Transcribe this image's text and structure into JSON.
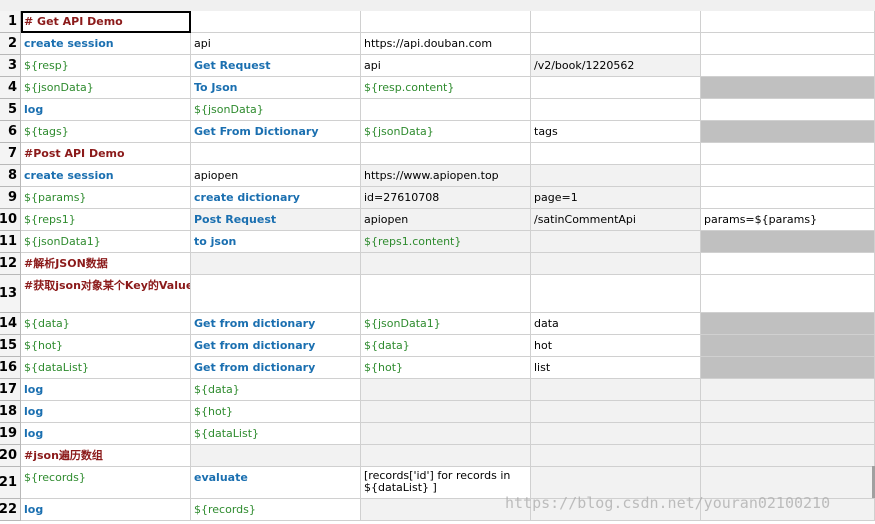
{
  "rows": [
    {
      "n": "1",
      "cells": [
        {
          "t": "# Get API Demo",
          "s": "cmt"
        },
        {
          "t": "",
          "s": "plain"
        },
        {
          "t": "",
          "s": "plain"
        },
        {
          "t": "",
          "s": "plain"
        },
        {
          "t": "",
          "s": "plain"
        }
      ]
    },
    {
      "n": "2",
      "cells": [
        {
          "t": "create session",
          "s": "kw"
        },
        {
          "t": "api",
          "s": "plain"
        },
        {
          "t": "https://api.douban.com",
          "s": "plain"
        },
        {
          "t": "",
          "s": "plain"
        },
        {
          "t": "",
          "s": "plain"
        }
      ]
    },
    {
      "n": "3",
      "cells": [
        {
          "t": "${resp}",
          "s": "var"
        },
        {
          "t": "Get Request",
          "s": "kw"
        },
        {
          "t": "api",
          "s": "plain"
        },
        {
          "t": "/v2/book/1220562",
          "s": "plain"
        },
        {
          "t": "",
          "s": "plain"
        }
      ]
    },
    {
      "n": "4",
      "cells": [
        {
          "t": "${jsonData}",
          "s": "var"
        },
        {
          "t": "To Json",
          "s": "kw"
        },
        {
          "t": "${resp.content}",
          "s": "var"
        },
        {
          "t": "",
          "s": "plain"
        },
        {
          "t": "",
          "s": "plain"
        }
      ]
    },
    {
      "n": "5",
      "cells": [
        {
          "t": "log",
          "s": "kw"
        },
        {
          "t": "${jsonData}",
          "s": "var"
        },
        {
          "t": "",
          "s": "plain"
        },
        {
          "t": "",
          "s": "plain"
        },
        {
          "t": "",
          "s": "plain"
        }
      ]
    },
    {
      "n": "6",
      "cells": [
        {
          "t": "${tags}",
          "s": "var"
        },
        {
          "t": "Get From Dictionary",
          "s": "kw"
        },
        {
          "t": "${jsonData}",
          "s": "var"
        },
        {
          "t": "tags",
          "s": "plain"
        },
        {
          "t": "",
          "s": "plain"
        }
      ]
    },
    {
      "n": "7",
      "cells": [
        {
          "t": "#Post API Demo",
          "s": "cmt"
        },
        {
          "t": "",
          "s": "plain"
        },
        {
          "t": "",
          "s": "plain"
        },
        {
          "t": "",
          "s": "plain"
        },
        {
          "t": "",
          "s": "plain"
        }
      ]
    },
    {
      "n": "8",
      "cells": [
        {
          "t": "create session",
          "s": "kw"
        },
        {
          "t": "apiopen",
          "s": "plain"
        },
        {
          "t": "https://www.apiopen.top",
          "s": "plain"
        },
        {
          "t": "",
          "s": "plain"
        },
        {
          "t": "",
          "s": "plain"
        }
      ]
    },
    {
      "n": "9",
      "cells": [
        {
          "t": "${params}",
          "s": "var"
        },
        {
          "t": "create dictionary",
          "s": "kw"
        },
        {
          "t": "id=27610708",
          "s": "plain"
        },
        {
          "t": "page=1",
          "s": "plain"
        },
        {
          "t": "",
          "s": "plain"
        }
      ]
    },
    {
      "n": "10",
      "cells": [
        {
          "t": "${reps1}",
          "s": "var"
        },
        {
          "t": "Post Request",
          "s": "kw"
        },
        {
          "t": "apiopen",
          "s": "plain"
        },
        {
          "t": "/satinCommentApi",
          "s": "plain"
        },
        {
          "t": "params=${params}",
          "s": "plain"
        }
      ]
    },
    {
      "n": "11",
      "cells": [
        {
          "t": "${jsonData1}",
          "s": "var"
        },
        {
          "t": "to json",
          "s": "kw"
        },
        {
          "t": "${reps1.content}",
          "s": "var"
        },
        {
          "t": "",
          "s": "plain"
        },
        {
          "t": "",
          "s": "plain"
        }
      ]
    },
    {
      "n": "12",
      "cells": [
        {
          "t": "#解析JSON数据",
          "s": "cmt"
        },
        {
          "t": "",
          "s": "plain"
        },
        {
          "t": "",
          "s": "plain"
        },
        {
          "t": "",
          "s": "plain"
        },
        {
          "t": "",
          "s": "plain"
        }
      ]
    },
    {
      "n": "13",
      "cells": [
        {
          "t": "#获取json对象某个Key的Value",
          "s": "cmt"
        },
        {
          "t": "",
          "s": "plain"
        },
        {
          "t": "",
          "s": "plain"
        },
        {
          "t": "",
          "s": "plain"
        },
        {
          "t": "",
          "s": "plain"
        }
      ]
    },
    {
      "n": "14",
      "cells": [
        {
          "t": "${data}",
          "s": "var"
        },
        {
          "t": "Get from dictionary",
          "s": "kw"
        },
        {
          "t": "${jsonData1}",
          "s": "var"
        },
        {
          "t": "data",
          "s": "plain"
        },
        {
          "t": "",
          "s": "plain"
        }
      ]
    },
    {
      "n": "15",
      "cells": [
        {
          "t": "${hot}",
          "s": "var"
        },
        {
          "t": "Get from dictionary",
          "s": "kw"
        },
        {
          "t": "${data}",
          "s": "var"
        },
        {
          "t": "hot",
          "s": "plain"
        },
        {
          "t": "",
          "s": "plain"
        }
      ]
    },
    {
      "n": "16",
      "cells": [
        {
          "t": "${dataList}",
          "s": "var"
        },
        {
          "t": "Get from dictionary",
          "s": "kw"
        },
        {
          "t": "${hot}",
          "s": "var"
        },
        {
          "t": "list",
          "s": "plain"
        },
        {
          "t": "",
          "s": "plain"
        }
      ]
    },
    {
      "n": "17",
      "cells": [
        {
          "t": "log",
          "s": "kw"
        },
        {
          "t": "${data}",
          "s": "var"
        },
        {
          "t": "",
          "s": "plain"
        },
        {
          "t": "",
          "s": "plain"
        },
        {
          "t": "",
          "s": "plain"
        }
      ]
    },
    {
      "n": "18",
      "cells": [
        {
          "t": "log",
          "s": "kw"
        },
        {
          "t": "${hot}",
          "s": "var"
        },
        {
          "t": "",
          "s": "plain"
        },
        {
          "t": "",
          "s": "plain"
        },
        {
          "t": "",
          "s": "plain"
        }
      ]
    },
    {
      "n": "19",
      "cells": [
        {
          "t": "log",
          "s": "kw"
        },
        {
          "t": "${dataList}",
          "s": "var"
        },
        {
          "t": "",
          "s": "plain"
        },
        {
          "t": "",
          "s": "plain"
        },
        {
          "t": "",
          "s": "plain"
        }
      ]
    },
    {
      "n": "20",
      "cells": [
        {
          "t": "#json遍历数组",
          "s": "cmt"
        },
        {
          "t": "",
          "s": "plain"
        },
        {
          "t": "",
          "s": "plain"
        },
        {
          "t": "",
          "s": "plain"
        },
        {
          "t": "",
          "s": "plain"
        }
      ]
    },
    {
      "n": "21",
      "cells": [
        {
          "t": "${records}",
          "s": "var"
        },
        {
          "t": "evaluate",
          "s": "kw"
        },
        {
          "t": "[records['id'] for records in ${dataList} ]",
          "s": "plain"
        },
        {
          "t": "",
          "s": "plain"
        },
        {
          "t": "",
          "s": "plain"
        }
      ]
    },
    {
      "n": "22",
      "cells": [
        {
          "t": "log",
          "s": "kw"
        },
        {
          "t": "${records}",
          "s": "var"
        },
        {
          "t": "",
          "s": "plain"
        },
        {
          "t": "",
          "s": "plain"
        },
        {
          "t": "",
          "s": "plain"
        }
      ]
    }
  ],
  "watermark": "https://blog.csdn.net/youran02100210",
  "colors": {
    "keyword": "#1a6fb0",
    "variable": "#2e8b2e",
    "comment": "#8b1a1a",
    "disabled": "#c0c0c0",
    "alt": "#f2f2f2"
  }
}
